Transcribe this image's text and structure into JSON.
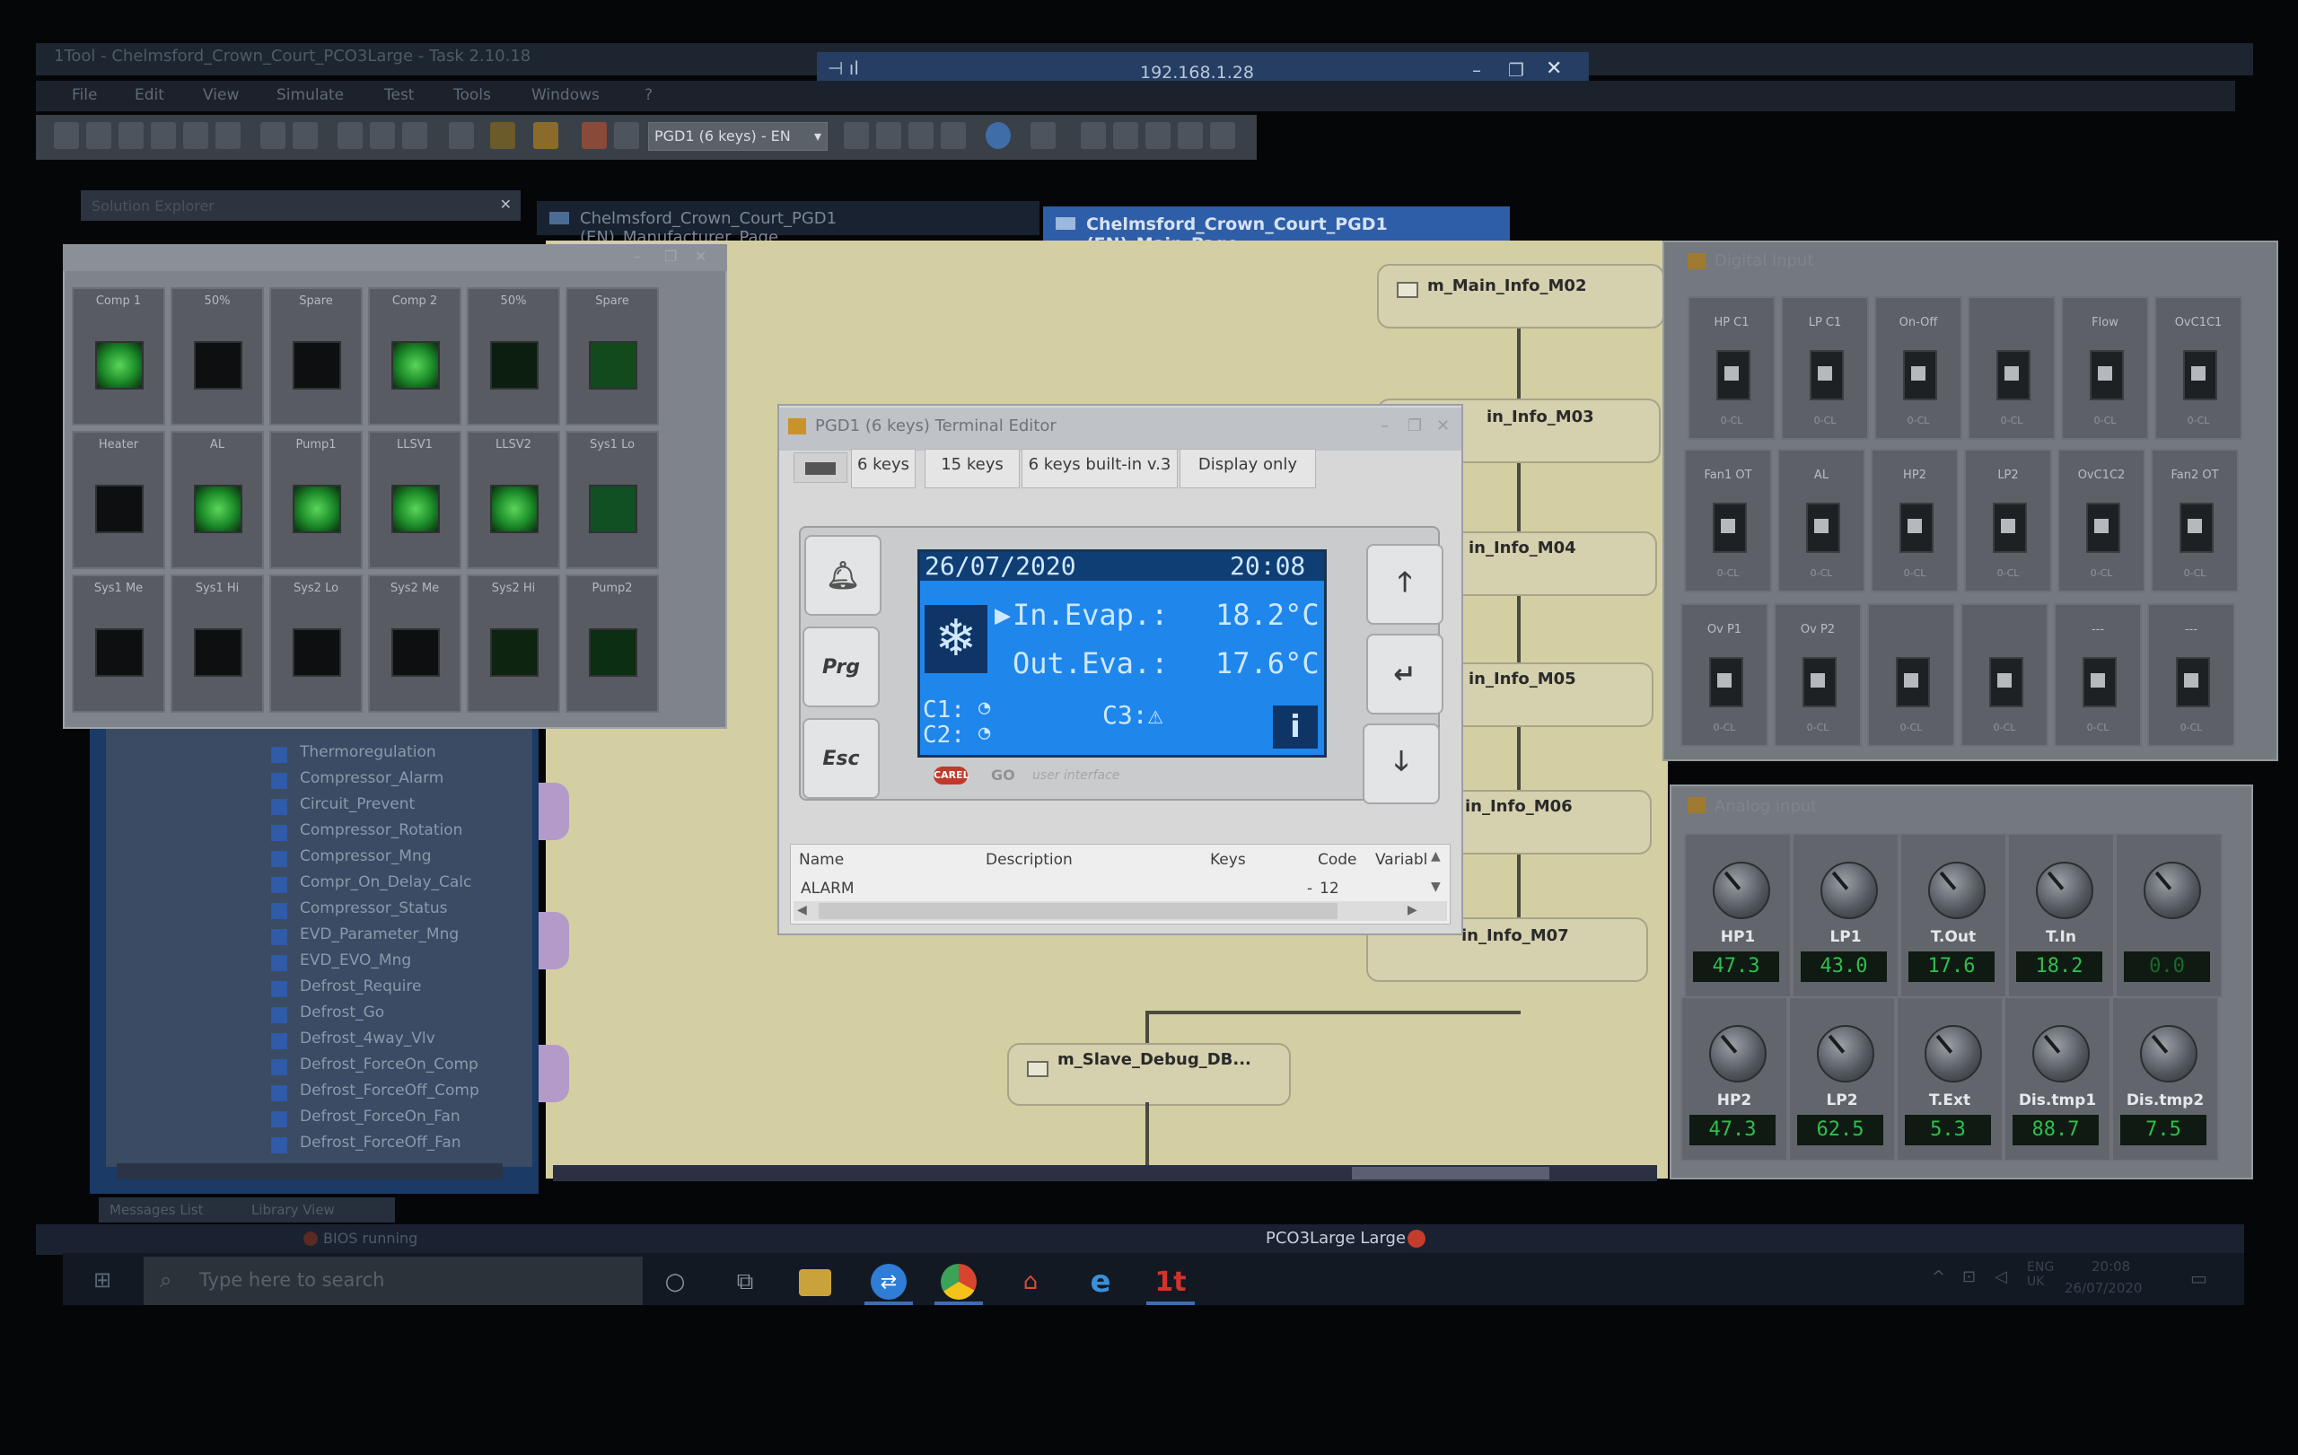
{
  "app": {
    "title": "1Tool - Chelmsford_Crown_Court_PCO3Large - Task 2.10.18"
  },
  "remote": {
    "ip": "192.168.1.28"
  },
  "menu": [
    "File",
    "Edit",
    "View",
    "Simulate",
    "Test",
    "Tools",
    "Windows",
    "?"
  ],
  "toolbar": {
    "terminal_select": "PGD1 (6 keys) - EN"
  },
  "tabs": {
    "solution_explorer": "Solution Explorer",
    "doc1": "Chelmsford_Crown_Court_PGD1 (EN)_Manufacturer_Page",
    "doc2": "Chelmsford_Crown_Court_PGD1 (EN)_Main_Page"
  },
  "io_panel": {
    "cells": [
      {
        "label": "Comp 1",
        "on": true
      },
      {
        "label": "50%",
        "on": false
      },
      {
        "label": "Spare",
        "on": false
      },
      {
        "label": "Comp 2",
        "on": true
      },
      {
        "label": "50%",
        "on": false
      },
      {
        "label": "Spare",
        "on": true
      },
      {
        "label": "Heater",
        "on": false
      },
      {
        "label": "AL",
        "on": true
      },
      {
        "label": "Pump1",
        "on": true
      },
      {
        "label": "LLSV1",
        "on": true
      },
      {
        "label": "LLSV2",
        "on": true
      },
      {
        "label": "Sys1 Lo",
        "on": true
      },
      {
        "label": "Sys1 Me",
        "on": false
      },
      {
        "label": "Sys1 Hi",
        "on": false
      },
      {
        "label": "Sys2 Lo",
        "on": false
      },
      {
        "label": "Sys2 Me",
        "on": false
      },
      {
        "label": "Sys2 Hi",
        "on": false
      },
      {
        "label": "Pump2",
        "on": false
      }
    ]
  },
  "explorer": {
    "items": [
      "Thermoregulation",
      "Compressor_Alarm",
      "Circuit_Prevent",
      "Compressor_Rotation",
      "Compressor_Mng",
      "Compr_On_Delay_Calc",
      "Compressor_Status",
      "EVD_Parameter_Mng",
      "EVD_EVO_Mng",
      "Defrost_Require",
      "Defrost_Go",
      "Defrost_4way_Vlv",
      "Defrost_ForceOn_Comp",
      "Defrost_ForceOff_Comp",
      "Defrost_ForceOn_Fan",
      "Defrost_ForceOff_Fan"
    ]
  },
  "flow": {
    "boxes": [
      "m_Main_Info_M02",
      "m_Main_Info_M03",
      "m_Main_Info_M04",
      "m_Main_Info_M05",
      "m_Main_Info_M06",
      "m_Main_Info_M07",
      "m_Slave_Debug_DB..."
    ],
    "visible_labels": [
      "m_Main_Info_M02",
      "in_Info_M03",
      "in_Info_M04",
      "in_Info_M05",
      "in_Info_M06",
      "in_Info_M07",
      "m_Slave_Debug_DB..."
    ]
  },
  "terminal": {
    "title": "PGD1 (6 keys) Terminal Editor",
    "tabs": [
      "6 keys",
      "15 keys",
      "6 keys built-in v.3",
      "Display only"
    ],
    "keys": {
      "prg": "Prg",
      "esc": "Esc"
    },
    "lcd": {
      "date": "26/07/2020",
      "time": "20:08",
      "line1_label": "In.Evap.:",
      "line1_value": "18.2°C",
      "line2_label": "Out.Eva.:",
      "line2_value": "17.6°C",
      "c1": "C1:",
      "c2": "C2:",
      "c3": "C3:⚠",
      "info": "i"
    },
    "brand": "GO",
    "brand_sub": "user interface",
    "grid": {
      "headers": [
        "Name",
        "Description",
        "Keys",
        "Code",
        "Variabl"
      ],
      "row": {
        "name": "ALARM",
        "description": "",
        "keys": "",
        "code": "12",
        "variable": ""
      }
    }
  },
  "digital_input": {
    "title": "Digital input",
    "cells": [
      {
        "label": "HP C1",
        "state": "0-CL"
      },
      {
        "label": "LP C1",
        "state": "0-CL"
      },
      {
        "label": "On-Off",
        "state": "0-CL"
      },
      {
        "label": "",
        "state": "0-CL"
      },
      {
        "label": "Flow",
        "state": "0-CL"
      },
      {
        "label": "OvC1C1",
        "state": "0-CL"
      },
      {
        "label": "Fan1 OT",
        "state": "0-CL"
      },
      {
        "label": "AL",
        "state": "0-CL"
      },
      {
        "label": "HP2",
        "state": "0-CL"
      },
      {
        "label": "LP2",
        "state": "0-CL"
      },
      {
        "label": "OvC1C2",
        "state": "0-CL"
      },
      {
        "label": "Fan2 OT",
        "state": "0-CL"
      },
      {
        "label": "Ov P1",
        "state": "0-CL"
      },
      {
        "label": "Ov P2",
        "state": "0-CL"
      },
      {
        "label": "",
        "state": "0-CL"
      },
      {
        "label": "",
        "state": "0-CL"
      },
      {
        "label": "---",
        "state": "0-CL"
      },
      {
        "label": "---",
        "state": "0-CL"
      }
    ]
  },
  "analog_input": {
    "title": "Analog input",
    "cells": [
      {
        "name": "HP1",
        "value": "47.3"
      },
      {
        "name": "LP1",
        "value": "43.0"
      },
      {
        "name": "T.Out",
        "value": "17.6"
      },
      {
        "name": "T.In",
        "value": "18.2"
      },
      {
        "name": "",
        "value": "0.0"
      },
      {
        "name": "HP2",
        "value": "47.3"
      },
      {
        "name": "LP2",
        "value": "62.5"
      },
      {
        "name": "T.Ext",
        "value": "5.3"
      },
      {
        "name": "Dis.tmp1",
        "value": "88.7"
      },
      {
        "name": "Dis.tmp2",
        "value": "7.5"
      }
    ]
  },
  "output": {
    "tabs": [
      "Messages List",
      "Library View"
    ]
  },
  "status": {
    "left": "BIOS running",
    "center": "PCO3Large Large"
  },
  "taskbar": {
    "search_placeholder": "Type here to search",
    "tray": "ENG UK",
    "clock_time": "20:08",
    "clock_date": "26/07/2020"
  }
}
